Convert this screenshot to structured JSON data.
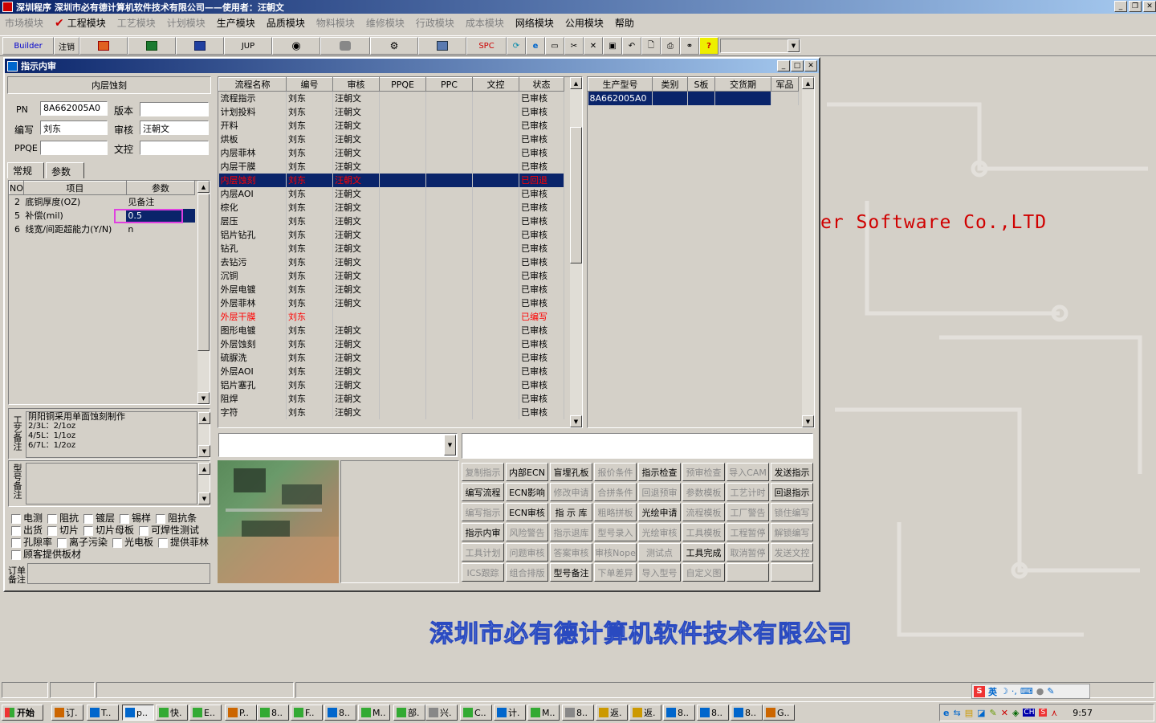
{
  "app": {
    "title": "深圳程序    深圳市必有德计算机软件技术有限公司——使用者：汪朝文"
  },
  "menu": [
    {
      "label": "市场模块",
      "enabled": false
    },
    {
      "label": "工程模块",
      "enabled": true,
      "checked": true
    },
    {
      "label": "工艺模块",
      "enabled": false
    },
    {
      "label": "计划模块",
      "enabled": false
    },
    {
      "label": "生产模块",
      "enabled": true
    },
    {
      "label": "品质模块",
      "enabled": true
    },
    {
      "label": "物料模块",
      "enabled": false
    },
    {
      "label": "维修模块",
      "enabled": false
    },
    {
      "label": "行政模块",
      "enabled": false
    },
    {
      "label": "成本模块",
      "enabled": false
    },
    {
      "label": "网络模块",
      "enabled": true
    },
    {
      "label": "公用模块",
      "enabled": true
    },
    {
      "label": "帮助",
      "enabled": true
    }
  ],
  "toolbar": {
    "builder": "Builder",
    "logout": "注销",
    "jup": "JUP",
    "spc": "SPC"
  },
  "bg": {
    "brand_en": "er Software Co.,LTD",
    "brand_cn": "深圳市必有德计算机软件技术有限公司"
  },
  "dialog": {
    "title": "指示内审",
    "left": {
      "header": "内层蚀刻",
      "pn_label": "PN",
      "pn_value": "8A662005A0",
      "version_label": "版本",
      "version_value": "",
      "writer_label": "编写",
      "writer_value": "刘东",
      "review_label": "审核",
      "review_value": "汪朝文",
      "ppqe_label": "PPQE",
      "ppqe_value": "",
      "wenkong_label": "文控",
      "wenkong_value": "",
      "tabs": [
        "常规",
        "参数"
      ],
      "param_headers": [
        "NO",
        "项目",
        "参数"
      ],
      "params": [
        {
          "no": "2",
          "item": "底铜厚度(OZ)",
          "value": "见备注"
        },
        {
          "no": "5",
          "item": "补偿(mil)",
          "value": "0.5"
        },
        {
          "no": "6",
          "item": "线宽/间距超能力(Y/N)",
          "value": "n"
        }
      ],
      "process_note_label": "工艺备注",
      "process_note": [
        "阴阳铜采用单面蚀刻制作",
        "2/3L：2/1oz",
        "4/5L：1/1oz",
        "6/7L：1/2oz"
      ],
      "model_note_label": "型号备注",
      "checks": [
        [
          "电测",
          "阻抗",
          "镀层",
          "锡样",
          "阻抗条"
        ],
        [
          "出货",
          "切片",
          "切片母板",
          "可焊性测试"
        ],
        [
          "孔隙率",
          "离子污染",
          "光电板",
          "提供菲林"
        ],
        [
          "顾客提供板材"
        ]
      ],
      "order_note_label": "订单备注"
    },
    "flow": {
      "headers": [
        "流程名称",
        "编号",
        "审核",
        "PPQE",
        "PPC",
        "文控",
        "状态"
      ],
      "rows": [
        [
          "流程指示",
          "刘东",
          "汪朝文",
          "",
          "",
          "",
          "已审核"
        ],
        [
          "计划投料",
          "刘东",
          "汪朝文",
          "",
          "",
          "",
          "已审核"
        ],
        [
          "开料",
          "刘东",
          "汪朝文",
          "",
          "",
          "",
          "已审核"
        ],
        [
          "烘板",
          "刘东",
          "汪朝文",
          "",
          "",
          "",
          "已审核"
        ],
        [
          "内层菲林",
          "刘东",
          "汪朝文",
          "",
          "",
          "",
          "已审核"
        ],
        [
          "内层干膜",
          "刘东",
          "汪朝文",
          "",
          "",
          "",
          "已审核"
        ],
        [
          "内层蚀刻",
          "刘东",
          "汪朝文",
          "",
          "",
          "",
          "已回退"
        ],
        [
          "内层AOI",
          "刘东",
          "汪朝文",
          "",
          "",
          "",
          "已审核"
        ],
        [
          "棕化",
          "刘东",
          "汪朝文",
          "",
          "",
          "",
          "已审核"
        ],
        [
          "层压",
          "刘东",
          "汪朝文",
          "",
          "",
          "",
          "已审核"
        ],
        [
          "铝片钻孔",
          "刘东",
          "汪朝文",
          "",
          "",
          "",
          "已审核"
        ],
        [
          "钻孔",
          "刘东",
          "汪朝文",
          "",
          "",
          "",
          "已审核"
        ],
        [
          "去钻污",
          "刘东",
          "汪朝文",
          "",
          "",
          "",
          "已审核"
        ],
        [
          "沉铜",
          "刘东",
          "汪朝文",
          "",
          "",
          "",
          "已审核"
        ],
        [
          "外层电镀",
          "刘东",
          "汪朝文",
          "",
          "",
          "",
          "已审核"
        ],
        [
          "外层菲林",
          "刘东",
          "汪朝文",
          "",
          "",
          "",
          "已审核"
        ],
        [
          "外层干膜",
          "刘东",
          "",
          "",
          "",
          "",
          "已编写"
        ],
        [
          "图形电镀",
          "刘东",
          "汪朝文",
          "",
          "",
          "",
          "已审核"
        ],
        [
          "外层蚀刻",
          "刘东",
          "汪朝文",
          "",
          "",
          "",
          "已审核"
        ],
        [
          "硫脲洗",
          "刘东",
          "汪朝文",
          "",
          "",
          "",
          "已审核"
        ],
        [
          "外层AOI",
          "刘东",
          "汪朝文",
          "",
          "",
          "",
          "已审核"
        ],
        [
          "铝片塞孔",
          "刘东",
          "汪朝文",
          "",
          "",
          "",
          "已审核"
        ],
        [
          "阻焊",
          "刘东",
          "汪朝文",
          "",
          "",
          "",
          "已审核"
        ],
        [
          "字符",
          "刘东",
          "汪朝文",
          "",
          "",
          "",
          "已审核"
        ]
      ],
      "selected_index": 6,
      "red_indices": [
        6,
        16
      ]
    },
    "product": {
      "headers": [
        "生产型号",
        "类别",
        "S板",
        "交货期",
        "军品"
      ],
      "rows": [
        [
          "8A662005A0",
          "",
          "",
          "",
          ""
        ]
      ]
    },
    "buttons": [
      [
        [
          "复制指示",
          false
        ],
        [
          "内部ECN",
          true
        ],
        [
          "盲埋孔板",
          true
        ],
        [
          "报价条件",
          false
        ],
        [
          "指示检查",
          true
        ],
        [
          "预审检查",
          false
        ],
        [
          "导入CAM",
          false
        ],
        [
          "发送指示",
          true
        ]
      ],
      [
        [
          "编写流程",
          true
        ],
        [
          "ECN影响",
          true
        ],
        [
          "修改申请",
          false
        ],
        [
          "合拼条件",
          false
        ],
        [
          "回退预审",
          false
        ],
        [
          "参数模板",
          false
        ],
        [
          "工艺计时",
          false
        ],
        [
          "回退指示",
          true
        ]
      ],
      [
        [
          "编写指示",
          false
        ],
        [
          "ECN审核",
          true
        ],
        [
          "指 示 库",
          true
        ],
        [
          "粗略拼板",
          false
        ],
        [
          "光绘申请",
          true
        ],
        [
          "流程模板",
          false
        ],
        [
          "工厂警告",
          false
        ],
        [
          "锁住编写",
          false
        ]
      ],
      [
        [
          "指示内审",
          true
        ],
        [
          "风险警告",
          false
        ],
        [
          "指示退库",
          false
        ],
        [
          "型号录入",
          false
        ],
        [
          "光绘审核",
          false
        ],
        [
          "工具模板",
          false
        ],
        [
          "工程暂停",
          false
        ],
        [
          "解锁编写",
          false
        ]
      ],
      [
        [
          "工具计划",
          false
        ],
        [
          "问题审核",
          false
        ],
        [
          "答案审核",
          false
        ],
        [
          "审核Nope",
          false
        ],
        [
          "测试点",
          false
        ],
        [
          "工具完成",
          true
        ],
        [
          "取消暂停",
          false
        ],
        [
          "发送文控",
          false
        ]
      ],
      [
        [
          "ICS跟踪",
          false
        ],
        [
          "组合排版",
          false
        ],
        [
          "型号备注",
          true
        ],
        [
          "下单差异",
          false
        ],
        [
          "导入型号",
          false
        ],
        [
          "自定义图",
          false
        ],
        [
          "",
          false
        ],
        [
          "",
          false
        ]
      ]
    ]
  },
  "taskbar": {
    "start": "开始",
    "items": [
      "订.",
      "T..",
      "p..",
      "快.",
      "E..",
      "P..",
      "8..",
      "F..",
      "8..",
      "M..",
      "部.",
      "兴.",
      "C..",
      "计.",
      "M..",
      "8..",
      "返.",
      "返.",
      "8..",
      "8..",
      "8..",
      "G.."
    ],
    "ime": "英",
    "clock": "9:57"
  }
}
